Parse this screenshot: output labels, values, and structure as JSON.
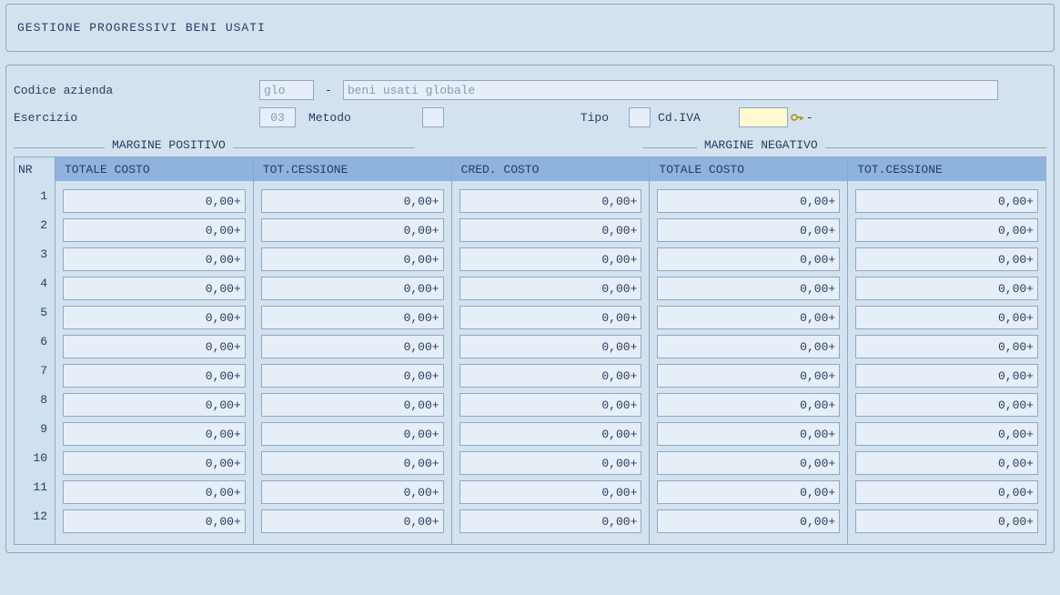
{
  "title": "GESTIONE PROGRESSIVI BENI USATI",
  "form": {
    "codice_azienda_label": "Codice azienda",
    "codice_azienda_value": "glo",
    "dash": "-",
    "codice_azienda_desc": "beni usati globale",
    "esercizio_label": "Esercizio",
    "esercizio_value": "03",
    "metodo_label": "Metodo",
    "metodo_value": "",
    "tipo_label": "Tipo",
    "tipo_value": "",
    "cdiva_label": "Cd.IVA",
    "cdiva_value": "",
    "cdiva_suffix": "-"
  },
  "sections": {
    "positivo": "MARGINE POSITIVO",
    "negativo": "MARGINE NEGATIVO"
  },
  "columns": {
    "nr": "NR",
    "c1": "TOTALE COSTO",
    "c2": "TOT.CESSIONE",
    "c3": "CRED. COSTO",
    "c4": "TOTALE COSTO",
    "c5": "TOT.CESSIONE"
  },
  "rows": [
    {
      "nr": "1",
      "c1": "0,00+",
      "c2": "0,00+",
      "c3": "0,00+",
      "c4": "0,00+",
      "c5": "0,00+"
    },
    {
      "nr": "2",
      "c1": "0,00+",
      "c2": "0,00+",
      "c3": "0,00+",
      "c4": "0,00+",
      "c5": "0,00+"
    },
    {
      "nr": "3",
      "c1": "0,00+",
      "c2": "0,00+",
      "c3": "0,00+",
      "c4": "0,00+",
      "c5": "0,00+"
    },
    {
      "nr": "4",
      "c1": "0,00+",
      "c2": "0,00+",
      "c3": "0,00+",
      "c4": "0,00+",
      "c5": "0,00+"
    },
    {
      "nr": "5",
      "c1": "0,00+",
      "c2": "0,00+",
      "c3": "0,00+",
      "c4": "0,00+",
      "c5": "0,00+"
    },
    {
      "nr": "6",
      "c1": "0,00+",
      "c2": "0,00+",
      "c3": "0,00+",
      "c4": "0,00+",
      "c5": "0,00+"
    },
    {
      "nr": "7",
      "c1": "0,00+",
      "c2": "0,00+",
      "c3": "0,00+",
      "c4": "0,00+",
      "c5": "0,00+"
    },
    {
      "nr": "8",
      "c1": "0,00+",
      "c2": "0,00+",
      "c3": "0,00+",
      "c4": "0,00+",
      "c5": "0,00+"
    },
    {
      "nr": "9",
      "c1": "0,00+",
      "c2": "0,00+",
      "c3": "0,00+",
      "c4": "0,00+",
      "c5": "0,00+"
    },
    {
      "nr": "10",
      "c1": "0,00+",
      "c2": "0,00+",
      "c3": "0,00+",
      "c4": "0,00+",
      "c5": "0,00+"
    },
    {
      "nr": "11",
      "c1": "0,00+",
      "c2": "0,00+",
      "c3": "0,00+",
      "c4": "0,00+",
      "c5": "0,00+"
    },
    {
      "nr": "12",
      "c1": "0,00+",
      "c2": "0,00+",
      "c3": "0,00+",
      "c4": "0,00+",
      "c5": "0,00+"
    }
  ]
}
